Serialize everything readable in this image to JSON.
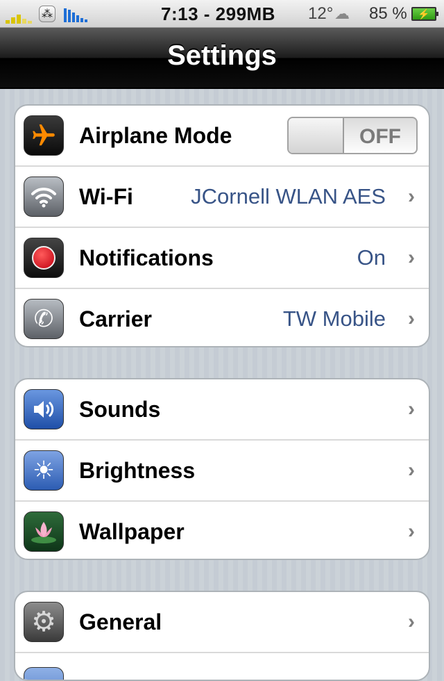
{
  "status_bar": {
    "time": "7:13 - 299MB",
    "temperature": "12°",
    "battery_percent": "85 %",
    "icons": [
      "signal-icon",
      "blackberry-icon",
      "network-bars-icon",
      "cloud-icon",
      "battery-icon"
    ]
  },
  "nav": {
    "title": "Settings"
  },
  "groups": [
    {
      "rows": [
        {
          "label": "Airplane Mode",
          "toggle": "OFF",
          "icon": "airplane-icon"
        },
        {
          "label": "Wi-Fi",
          "value": "JCornell WLAN AES",
          "icon": "wifi-icon"
        },
        {
          "label": "Notifications",
          "value": "On",
          "icon": "notifications-icon"
        },
        {
          "label": "Carrier",
          "value": "TW Mobile",
          "icon": "phone-icon"
        }
      ]
    },
    {
      "rows": [
        {
          "label": "Sounds",
          "icon": "speaker-icon"
        },
        {
          "label": "Brightness",
          "icon": "sun-icon"
        },
        {
          "label": "Wallpaper",
          "icon": "lotus-icon"
        }
      ]
    },
    {
      "rows": [
        {
          "label": "General",
          "icon": "gear-icon"
        }
      ]
    }
  ],
  "colors": {
    "value_text": "#385487",
    "airplane_icon_bg": "#1a1a1a",
    "airplane_glyph": "#ff8a00",
    "notifications_dot": "#e0141c",
    "sounds_icon_bg": "#2f5fb8",
    "brightness_icon_bg": "#3a66b8"
  }
}
